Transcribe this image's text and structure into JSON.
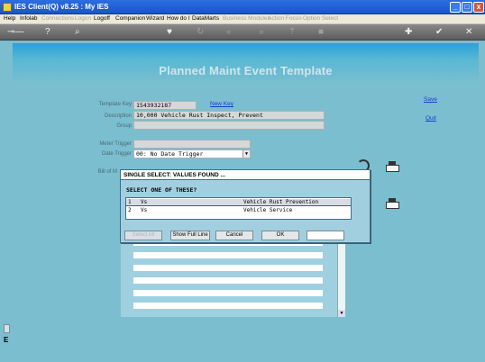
{
  "window": {
    "title": "IES Client(Q) v8.25 : My IES",
    "minimize": "_",
    "maximize": "□",
    "close": "x"
  },
  "menu": [
    {
      "label": "Help",
      "enabled": true
    },
    {
      "label": "Infolab",
      "enabled": true
    },
    {
      "label": "Connections",
      "enabled": false
    },
    {
      "label": "Logon",
      "enabled": false
    },
    {
      "label": "Logoff",
      "enabled": true
    },
    {
      "label": "Companion",
      "enabled": true
    },
    {
      "label": "Wizard",
      "enabled": true
    },
    {
      "label": "How do I",
      "enabled": true
    },
    {
      "label": "DataMarts",
      "enabled": true
    },
    {
      "label": "Business Modules",
      "enabled": false
    },
    {
      "label": "Action Focus",
      "enabled": false
    },
    {
      "label": "Option Select",
      "enabled": false
    }
  ],
  "toolbar": {
    "icons": [
      "key-icon",
      "help-icon",
      "search-icon",
      "heart-icon",
      "refresh-icon",
      "rewind-icon",
      "forward-icon",
      "up-icon",
      "stop-icon",
      "plus-icon",
      "check-icon",
      "close-icon"
    ]
  },
  "page": {
    "title": "Planned Maint Event Template"
  },
  "form": {
    "template_key_label": "Template Key",
    "template_key_value": "1543932187",
    "new_key_link": "New Key",
    "description_label": "Description",
    "description_value": "10,000 Vehicle Rust Inspect, Prevent",
    "group_label": "Group",
    "group_value": "",
    "meter_trigger_label": "Meter Trigger",
    "meter_trigger_value": "",
    "date_trigger_label": "Date Trigger",
    "date_trigger_value": "00: No Date Trigger",
    "bill_of_materials_label": "Bill of M"
  },
  "actions": {
    "save": "Save",
    "quit": "Quit"
  },
  "dialog": {
    "title": "SINGLE SELECT: VALUES FOUND ...",
    "prompt": "SELECT ONE OF THESE?",
    "rows": [
      {
        "num": "1",
        "code": "Vs",
        "desc": "Vehicle Rust Prevention"
      },
      {
        "num": "2",
        "code": "Vs",
        "desc": "Vehicle Service"
      }
    ],
    "buttons": {
      "select_all": "Select All",
      "show_full_line": "Show Full Line",
      "cancel": "Cancel",
      "ok": "OK"
    },
    "search_value": ""
  },
  "colors": {
    "background": "#7bbecf",
    "banner": "#2aa1d8",
    "link": "#1a3bd0"
  }
}
